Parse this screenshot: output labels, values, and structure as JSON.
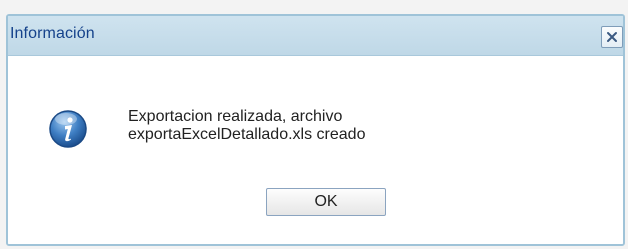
{
  "dialog": {
    "title": "Información",
    "message_line1": "Exportacion realizada, archivo",
    "message_line2": "exportaExcelDetallado.xls creado",
    "ok_label": "OK",
    "icon": "info-icon",
    "close_icon": "close-icon"
  },
  "colors": {
    "titlebar": "#c6deeb",
    "title_text": "#15428b",
    "border": "#9fc3d8",
    "info_icon_blue": "#2f6fb3"
  }
}
